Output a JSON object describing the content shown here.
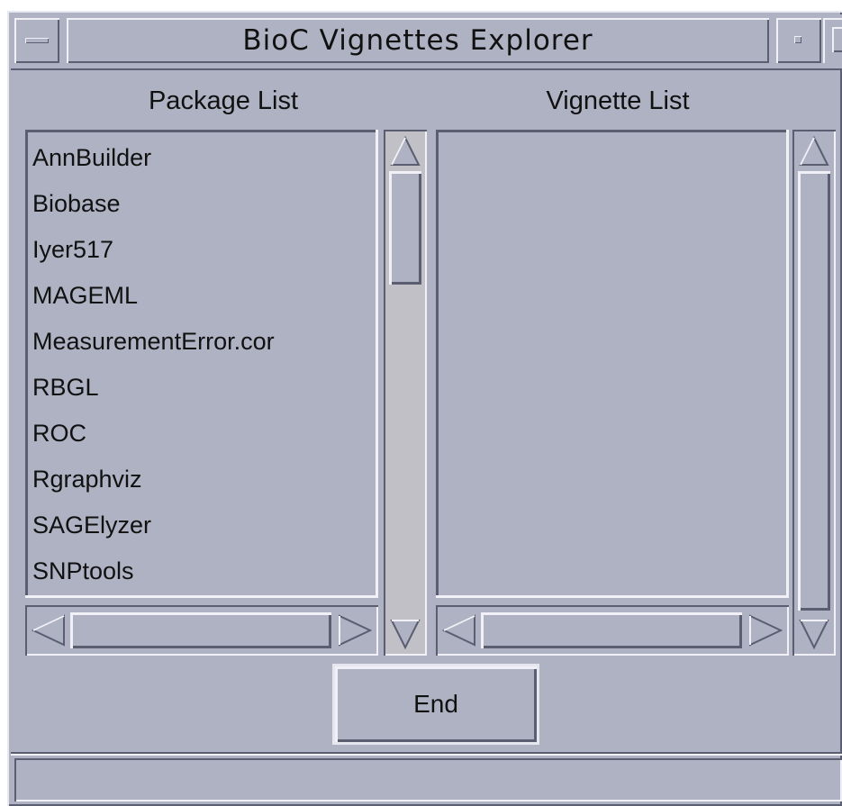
{
  "window": {
    "title": "BioC Vignettes Explorer"
  },
  "package_list": {
    "label": "Package List",
    "items": [
      "AnnBuilder",
      "Biobase",
      "Iyer517",
      "MAGEML",
      "MeasurementError.cor",
      "RBGL",
      "ROC",
      "Rgraphviz",
      "SAGElyzer",
      "SNPtools"
    ]
  },
  "vignette_list": {
    "label": "Vignette List",
    "items": []
  },
  "buttons": {
    "end_label": "End"
  },
  "status": {
    "text": ""
  },
  "icons": {
    "window_menu": "window-menu-icon",
    "minimize": "minimize-icon",
    "maximize": "maximize-icon",
    "scroll_up": "triangle-up-icon",
    "scroll_down": "triangle-down-icon",
    "scroll_left": "triangle-left-icon",
    "scroll_right": "triangle-right-icon"
  }
}
